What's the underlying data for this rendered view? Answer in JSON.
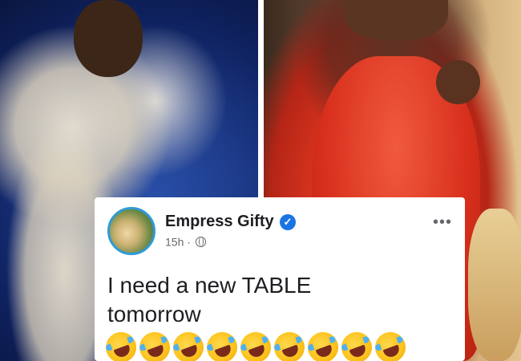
{
  "post": {
    "author_name": "Empress Gifty",
    "verified_icon": "verified-badge-icon",
    "time": "15h",
    "separator": "·",
    "audience_icon": "globe-icon",
    "more_icon": "more-options-icon",
    "more_glyph": "•••",
    "text": "I need a new TABLE\ntomorrow",
    "emoji_name": "rolling-on-floor-laughing",
    "emoji_count": 9
  },
  "colors": {
    "verified": "#1b74e4",
    "avatar_ring": "#2f9bd6",
    "left_backdrop": "#1d3b8a",
    "right_gown": "#d9351f"
  }
}
